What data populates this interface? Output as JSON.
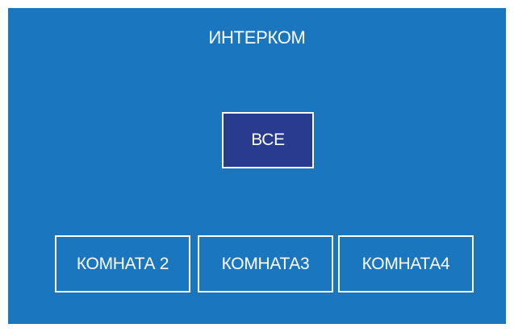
{
  "header": {
    "title": "ИНТЕРКОМ"
  },
  "buttons": {
    "all": "ВСЕ",
    "rooms": [
      "КОМНАТА 2",
      "КОМНАТА3",
      "КОМНАТА4"
    ]
  },
  "colors": {
    "panel_background": "#1a77bf",
    "selected_button": "#283b8e",
    "border_and_text": "#ffffff"
  }
}
